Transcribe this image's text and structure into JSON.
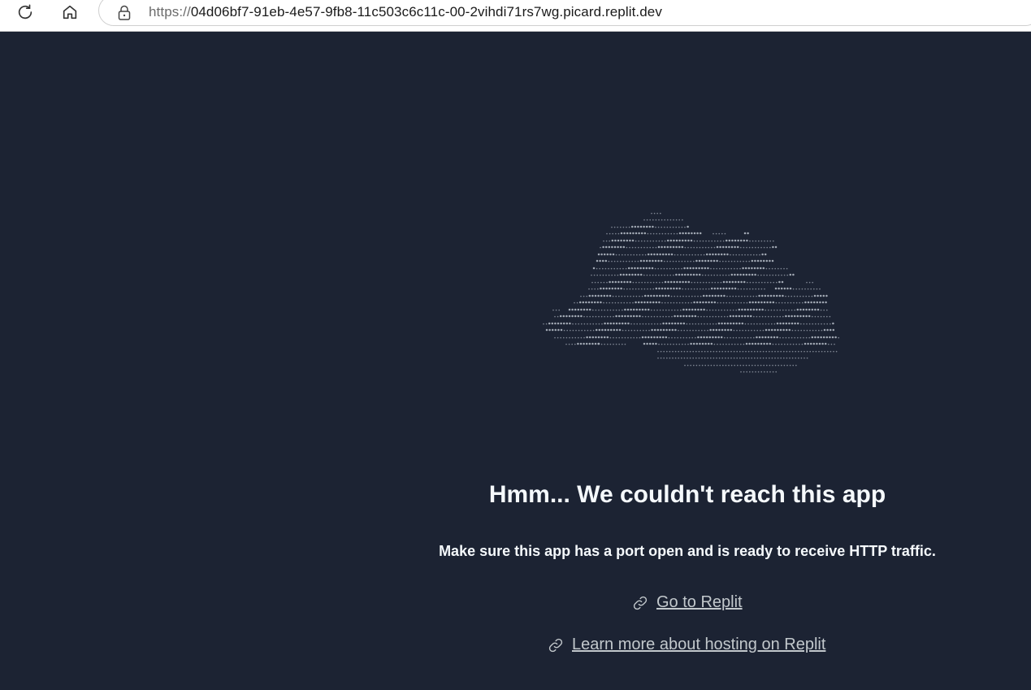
{
  "browser": {
    "url_scheme": "https://",
    "url_rest": "04d06bf7-91eb-4e57-9fb8-11c503c6c11c-00-2vihdi71rs7wg.picard.replit.dev",
    "icons": [
      "reload-icon",
      "home-icon",
      "lock-icon"
    ]
  },
  "page": {
    "heading": "Hmm... We couldn't reach this app",
    "subtext": "Make sure this app has a port open and is ready to receive HTTP traffic.",
    "links": [
      {
        "label": "Go to Replit",
        "icon": "link-icon"
      },
      {
        "label": "Learn more about hosting on Replit",
        "icon": "link-icon"
      }
    ]
  },
  "colors": {
    "background": "#1c2333",
    "heading": "#f5f9fc",
    "link": "#c2c8cc",
    "ascii_art": "#aab1bc"
  }
}
